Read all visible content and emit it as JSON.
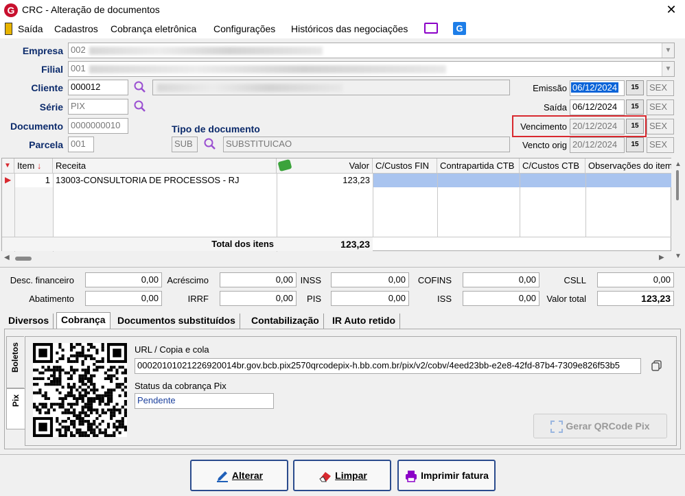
{
  "window": {
    "title": "CRC - Alteração de documentos",
    "app_logo_letter": "G",
    "close_glyph": "✕"
  },
  "menu": {
    "items": [
      "Saída",
      "Cadastros",
      "Cobrança eletrônica",
      "Configurações",
      "Históricos das negociações"
    ],
    "g_logo_letter": "G"
  },
  "form": {
    "empresa": {
      "label": "Empresa",
      "code": "002"
    },
    "filial": {
      "label": "Filial",
      "code": "001"
    },
    "cliente": {
      "label": "Cliente",
      "code": "000012"
    },
    "serie": {
      "label": "Série",
      "value": "PIX"
    },
    "documento": {
      "label": "Documento",
      "value": "0000000010"
    },
    "parcela": {
      "label": "Parcela",
      "value": "001"
    },
    "tipo_documento": {
      "label": "Tipo de documento",
      "code": "SUB",
      "name": "SUBSTITUICAO"
    },
    "dates": [
      {
        "label": "Emissão",
        "value": "06/12/2024",
        "day": "SEX",
        "selected": true
      },
      {
        "label": "Saída",
        "value": "06/12/2024",
        "day": "SEX"
      },
      {
        "label": "Vencimento",
        "value": "20/12/2024",
        "day": "SEX"
      },
      {
        "label": "Vencto orig",
        "value": "20/12/2024",
        "day": "SEX"
      }
    ],
    "calendar_glyph": "15"
  },
  "grid": {
    "headers": [
      "Item",
      "Receita",
      "Valor",
      "C/Custos FIN",
      "Contrapartida CTB",
      "C/Custos CTB",
      "Observações do item"
    ],
    "rows": [
      {
        "item": "1",
        "receita": "13003-CONSULTORIA DE PROCESSOS - RJ",
        "valor": "123,23"
      }
    ],
    "total_label": "Total dos itens",
    "total_value": "123,23"
  },
  "totals": {
    "desc_financeiro": {
      "label": "Desc. financeiro",
      "value": "0,00"
    },
    "acrescimo": {
      "label": "Acréscimo",
      "value": "0,00"
    },
    "inss": {
      "label": "INSS",
      "value": "0,00"
    },
    "cofins": {
      "label": "COFINS",
      "value": "0,00"
    },
    "csll": {
      "label": "CSLL",
      "value": "0,00"
    },
    "abatimento": {
      "label": "Abatimento",
      "value": "0,00"
    },
    "irrf": {
      "label": "IRRF",
      "value": "0,00"
    },
    "pis": {
      "label": "PIS",
      "value": "0,00"
    },
    "iss": {
      "label": "ISS",
      "value": "0,00"
    },
    "valor_total": {
      "label": "Valor total",
      "value": "123,23"
    }
  },
  "tabs": [
    "Diversos",
    "Cobrança",
    "Documentos substituídos",
    "Contabilização",
    "IR Auto retido"
  ],
  "vtabs": [
    "Boletos",
    "Pix"
  ],
  "pix": {
    "url_label": "URL / Copia e cola",
    "url_value": "00020101021226920014br.gov.bcb.pix2570qrcodepix-h.bb.com.br/pix/v2/cobv/4eed23bb-e2e8-42fd-87b4-7309e826f53b5",
    "status_label": "Status da cobrança Pix",
    "status_value": "Pendente",
    "qr_button": "Gerar QRCode Pix"
  },
  "buttons": {
    "alterar": "Alterar",
    "limpar": "Limpar",
    "imprimir": "Imprimir fatura"
  },
  "colors": {
    "label_blue": "#0b2a6b",
    "selection_blue": "#0a64d8",
    "row_highlight": "#a9c4ef",
    "highlight_box": "#d8282e"
  }
}
